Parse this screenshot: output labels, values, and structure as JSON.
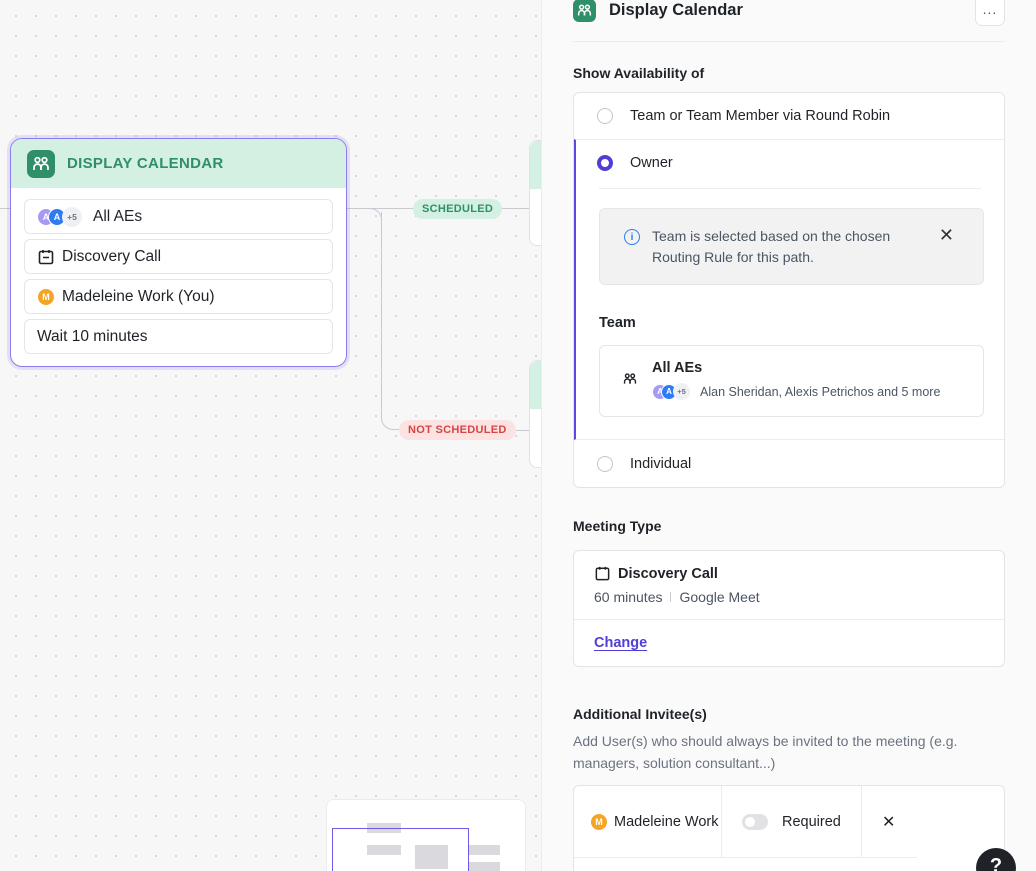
{
  "canvas": {
    "node": {
      "title": "DISPLAY CALENDAR",
      "rows": {
        "team": {
          "more": "+5",
          "label": "All AEs",
          "avatar1": "A",
          "avatar2": "A"
        },
        "meeting": {
          "label": "Discovery Call"
        },
        "owner": {
          "avatar": "M",
          "label": "Madeleine Work (You)"
        },
        "wait": {
          "label": "Wait 10 minutes"
        }
      }
    },
    "edges": {
      "scheduled": "SCHEDULED",
      "not_scheduled": "NOT SCHEDULED"
    }
  },
  "panel": {
    "title": "Display Calendar",
    "menu_icon": "...",
    "availability": {
      "label": "Show Availability of",
      "options": {
        "round_robin": "Team or Team Member via Round Robin",
        "owner": "Owner",
        "individual": "Individual"
      },
      "selected": "owner",
      "info": {
        "text": "Team is selected based on the chosen Routing Rule for this path.",
        "icon": "i",
        "close": "✕"
      },
      "team": {
        "label": "Team",
        "name": "All AEs",
        "more": "+5",
        "avatar1": "A",
        "avatar2": "A",
        "members": "Alan Sheridan, Alexis Petrichos and 5 more"
      }
    },
    "meeting_type": {
      "label": "Meeting Type",
      "name": "Discovery Call",
      "duration": "60 minutes",
      "provider": "Google Meet",
      "change": "Change"
    },
    "additional_invitees": {
      "label": "Additional Invitee(s)",
      "description": "Add User(s) who should always be invited to the meeting (e.g. managers, solution consultant...)",
      "invitee": {
        "avatar": "M",
        "name": "Madeleine Work",
        "required_label": "Required",
        "remove": "✕"
      }
    }
  },
  "help": "?",
  "colors": {
    "accent": "#5b4ae0",
    "green": "#2f8f69",
    "green_bg": "#d4f0e3",
    "red": "#d64545",
    "red_bg": "#fde2e2"
  }
}
